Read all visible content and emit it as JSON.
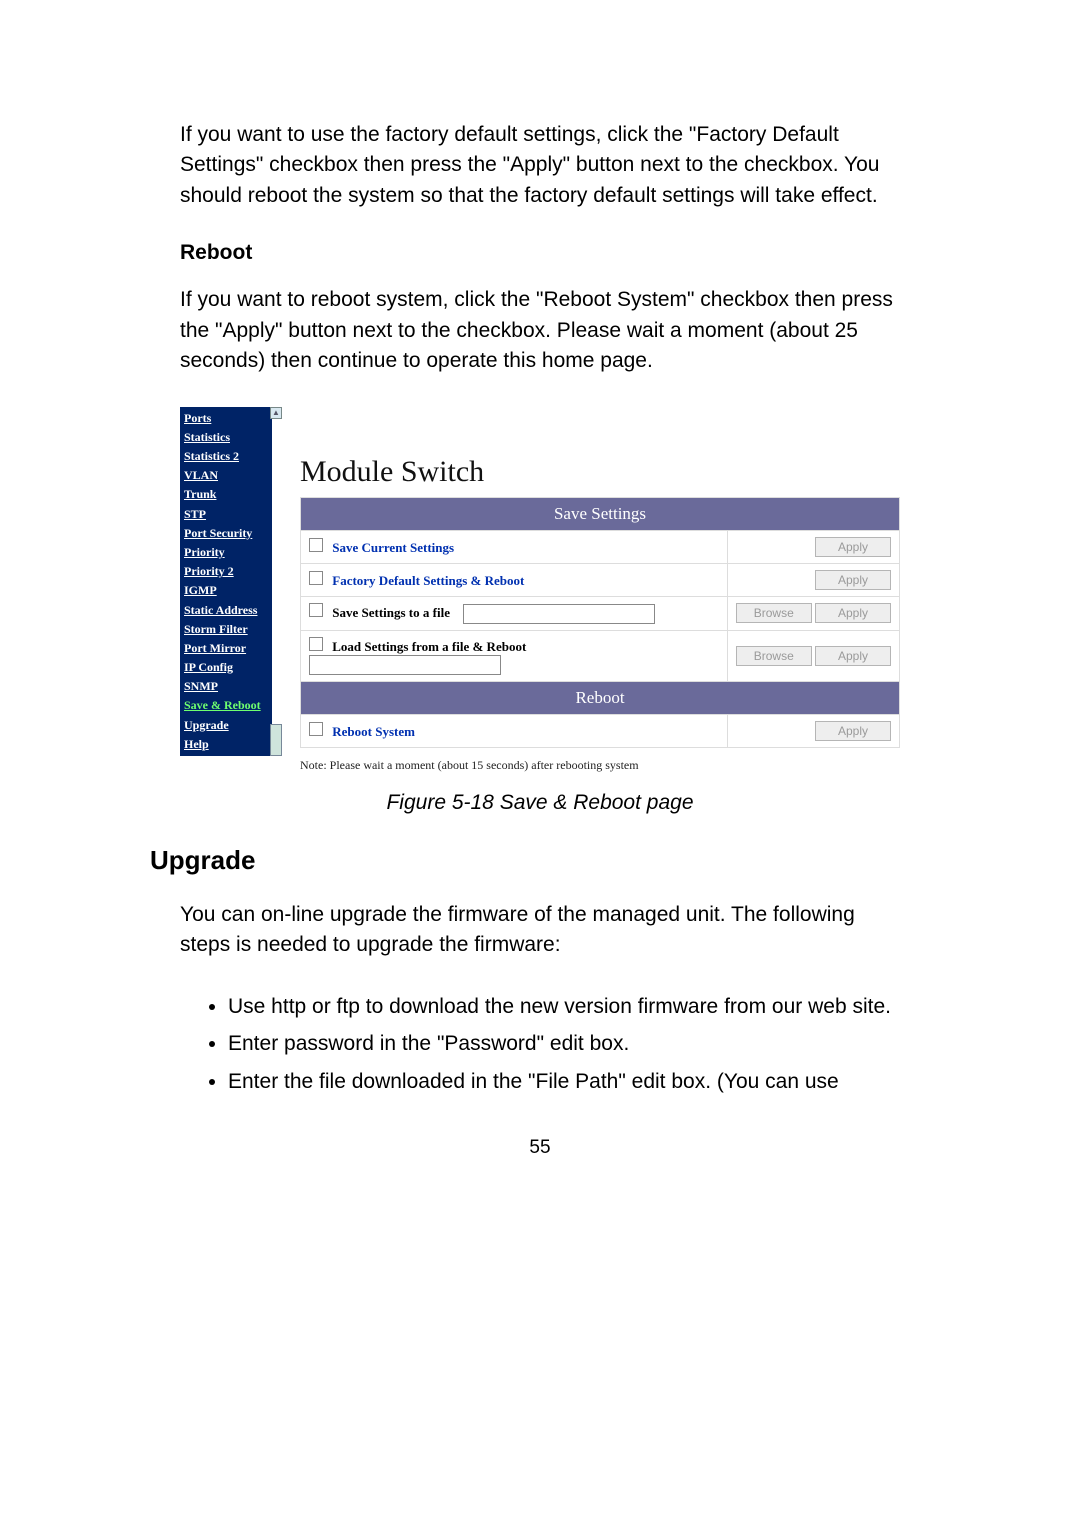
{
  "doc": {
    "para1": "If you want to use the factory default settings, click the \"Factory Default Settings\" checkbox then press the \"Apply\" button next to the checkbox. You should reboot the system so that the factory default settings will take effect.",
    "reboot_heading": "Reboot",
    "para2": "If you want to reboot system, click the \"Reboot System\" checkbox then press the \"Apply\" button next to the checkbox. Please wait a moment (about 25 seconds) then continue to operate this home page.",
    "figure_caption": "Figure 5-18 Save & Reboot page",
    "upgrade_heading": "Upgrade",
    "para3": "You can on-line upgrade the firmware of the managed unit. The following steps is needed to upgrade the firmware:",
    "bullets": [
      "Use http or ftp to download the new version firmware from our web site.",
      "Enter password in the \"Password\" edit box.",
      "Enter the file downloaded in the \"File Path\" edit box. (You can use"
    ],
    "page_number": "55"
  },
  "screenshot": {
    "sidebar": {
      "items": [
        "Ports",
        "Statistics",
        "Statistics 2",
        "VLAN",
        "Trunk",
        "STP",
        "Port Security",
        "Priority",
        "Priority 2",
        "IGMP",
        "Static Address",
        "Storm Filter",
        "Port Mirror",
        "IP Config",
        "SNMP",
        "Save & Reboot",
        "Upgrade",
        "Help"
      ],
      "active_index": 15
    },
    "title": "Module Switch",
    "save_header": "Save Settings",
    "row_save_current": "Save Current Settings",
    "row_factory_default": "Factory Default Settings & Reboot",
    "row_save_to_file": "Save Settings to a file",
    "row_load_from_file": "Load Settings from a file & Reboot",
    "reboot_header": "Reboot",
    "row_reboot_system": "Reboot System",
    "btn_apply": "Apply",
    "btn_browse": "Browse",
    "note": "Note: Please wait a moment (about 15 seconds) after rebooting system"
  }
}
